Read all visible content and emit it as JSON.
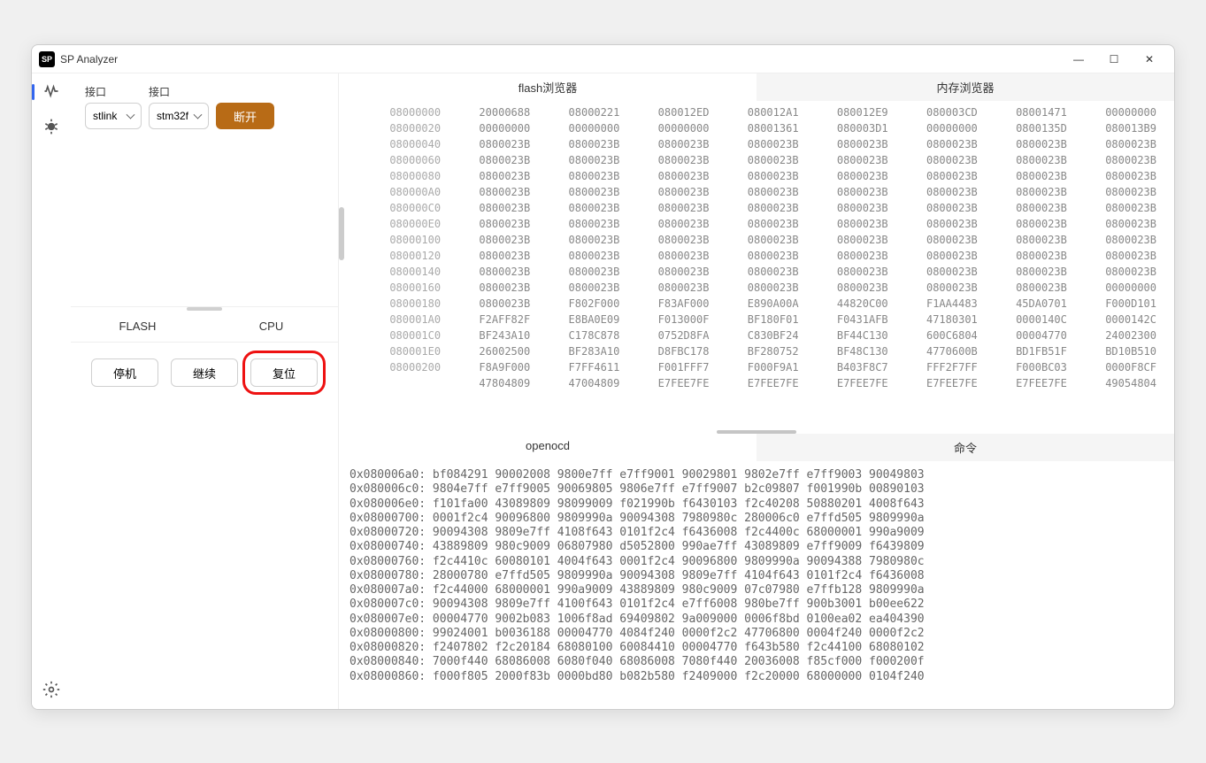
{
  "title": "SP Analyzer",
  "logo": "SP",
  "win": {
    "min": "—",
    "max": "☐",
    "close": "✕"
  },
  "leftTabs": {
    "flash": "FLASH",
    "cpu": "CPU"
  },
  "connect": {
    "label1": "接口",
    "label2": "接口",
    "sel1": "stlink",
    "sel2": "stm32f",
    "disconnect": "断开"
  },
  "cpuBtns": {
    "halt": "停机",
    "resume": "继续",
    "reset": "复位"
  },
  "topTabs": {
    "flash": "flash浏览器",
    "mem": "内存浏览器"
  },
  "botTabs": {
    "ocd": "openocd",
    "cmd": "命令"
  },
  "hex": {
    "rows": [
      [
        "08000000",
        "20000688",
        "08000221",
        "080012ED",
        "080012A1",
        "080012E9",
        "080003CD",
        "08001471",
        "00000000"
      ],
      [
        "08000020",
        "00000000",
        "00000000",
        "00000000",
        "08001361",
        "080003D1",
        "00000000",
        "0800135D",
        "080013B9"
      ],
      [
        "08000040",
        "0800023B",
        "0800023B",
        "0800023B",
        "0800023B",
        "0800023B",
        "0800023B",
        "0800023B",
        "0800023B"
      ],
      [
        "08000060",
        "0800023B",
        "0800023B",
        "0800023B",
        "0800023B",
        "0800023B",
        "0800023B",
        "0800023B",
        "0800023B"
      ],
      [
        "08000080",
        "0800023B",
        "0800023B",
        "0800023B",
        "0800023B",
        "0800023B",
        "0800023B",
        "0800023B",
        "0800023B"
      ],
      [
        "080000A0",
        "0800023B",
        "0800023B",
        "0800023B",
        "0800023B",
        "0800023B",
        "0800023B",
        "0800023B",
        "0800023B"
      ],
      [
        "080000C0",
        "0800023B",
        "0800023B",
        "0800023B",
        "0800023B",
        "0800023B",
        "0800023B",
        "0800023B",
        "0800023B"
      ],
      [
        "080000E0",
        "0800023B",
        "0800023B",
        "0800023B",
        "0800023B",
        "0800023B",
        "0800023B",
        "0800023B",
        "0800023B"
      ],
      [
        "08000100",
        "0800023B",
        "0800023B",
        "0800023B",
        "0800023B",
        "0800023B",
        "0800023B",
        "0800023B",
        "0800023B"
      ],
      [
        "08000120",
        "0800023B",
        "0800023B",
        "0800023B",
        "0800023B",
        "0800023B",
        "0800023B",
        "0800023B",
        "0800023B"
      ],
      [
        "08000140",
        "0800023B",
        "0800023B",
        "0800023B",
        "0800023B",
        "0800023B",
        "0800023B",
        "0800023B",
        "0800023B"
      ],
      [
        "08000160",
        "0800023B",
        "0800023B",
        "0800023B",
        "0800023B",
        "0800023B",
        "0800023B",
        "0800023B",
        "00000000"
      ],
      [
        "08000180",
        "0800023B",
        "F802F000",
        "F83AF000",
        "E890A00A",
        "44820C00",
        "F1AA4483",
        "45DA0701",
        "F000D101"
      ],
      [
        "080001A0",
        "F2AFF82F",
        "E8BA0E09",
        "F013000F",
        "BF180F01",
        "F0431AFB",
        "47180301",
        "0000140C",
        "0000142C"
      ],
      [
        "080001C0",
        "BF243A10",
        "C178C878",
        "0752D8FA",
        "C830BF24",
        "BF44C130",
        "600C6804",
        "00004770",
        "24002300"
      ],
      [
        "080001E0",
        "26002500",
        "BF283A10",
        "D8FBC178",
        "BF280752",
        "BF48C130",
        "4770600B",
        "BD1FB51F",
        "BD10B510"
      ],
      [
        "08000200",
        "F8A9F000",
        "F7FF4611",
        "F001FFF7",
        "F000F9A1",
        "B403F8C7",
        "FFF2F7FF",
        "F000BC03",
        "0000F8CF"
      ],
      [
        "",
        "47804809",
        "47004809",
        "E7FEE7FE",
        "E7FEE7FE",
        "E7FEE7FE",
        "E7FEE7FE",
        "E7FEE7FE",
        "49054804"
      ]
    ]
  },
  "log": "0x080006a0: bf084291 90002008 9800e7ff e7ff9001 90029801 9802e7ff e7ff9003 90049803\n0x080006c0: 9804e7ff e7ff9005 90069805 9806e7ff e7ff9007 b2c09807 f001990b 00890103\n0x080006e0: f101fa00 43089809 98099009 f021990b f6430103 f2c40208 50880201 4008f643\n0x08000700: 0001f2c4 90096800 9809990a 90094308 7980980c 280006c0 e7ffd505 9809990a\n0x08000720: 90094308 9809e7ff 4108f643 0101f2c4 f6436008 f2c4400c 68000001 990a9009\n0x08000740: 43889809 980c9009 06807980 d5052800 990ae7ff 43089809 e7ff9009 f6439809\n0x08000760: f2c4410c 60080101 4004f643 0001f2c4 90096800 9809990a 90094388 7980980c\n0x08000780: 28000780 e7ffd505 9809990a 90094308 9809e7ff 4104f643 0101f2c4 f6436008\n0x080007a0: f2c44000 68000001 990a9009 43889809 980c9009 07c07980 e7ffb128 9809990a\n0x080007c0: 90094308 9809e7ff 4100f643 0101f2c4 e7ff6008 980be7ff 900b3001 b00ee622\n0x080007e0: 00004770 9002b083 1006f8ad 69409802 9a009000 0006f8bd 0100ea02 ea404390\n0x08000800: 99024001 b0036188 00004770 4084f240 0000f2c2 47706800 0004f240 0000f2c2\n0x08000820: f2407802 f2c20184 68080100 60084410 00004770 f643b580 f2c44100 68080102\n0x08000840: 7000f440 68086008 6080f040 68086008 7080f440 20036008 f85cf000 f000200f\n0x08000860: f000f805 2000f83b 0000bd80 b082b580 f2409000 f2c20000 68000000 0104f240"
}
